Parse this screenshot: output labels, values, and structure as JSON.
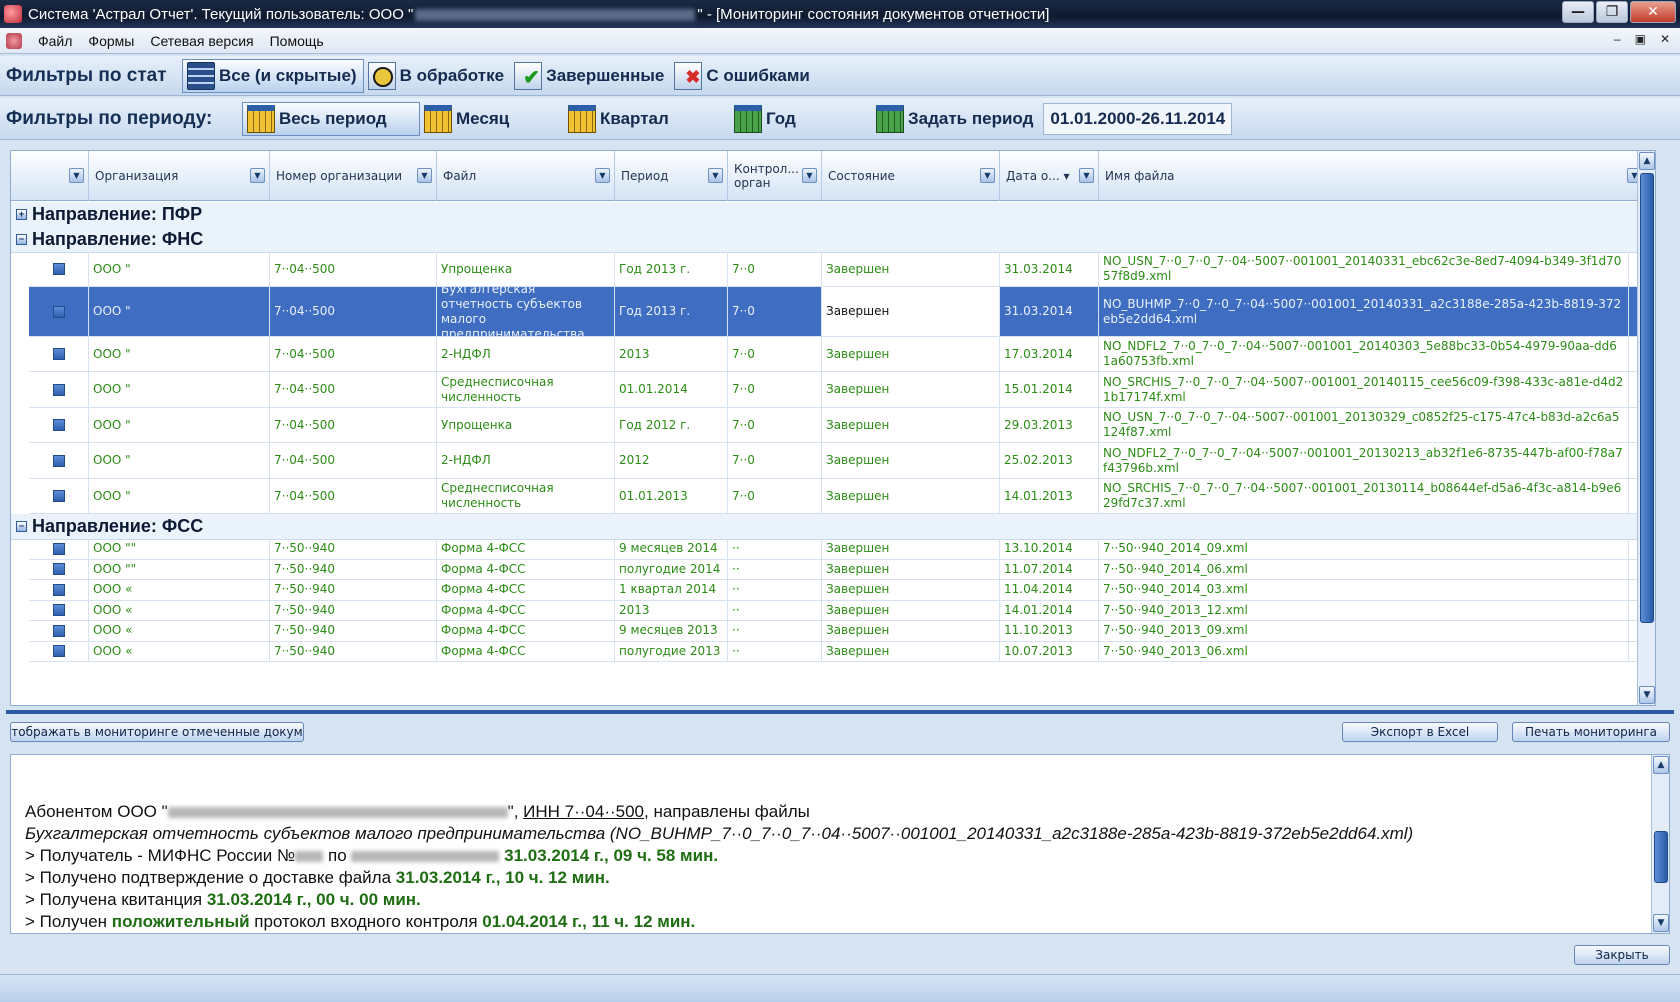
{
  "window": {
    "title_prefix": "Система 'Астрал Отчет'. Текущий пользователь: ООО \"",
    "title_suffix": "\" - [Мониторинг состояния документов отчетности]",
    "min": "—",
    "max": "❐",
    "close": "✕"
  },
  "menu": [
    "Файл",
    "Формы",
    "Сетевая версия",
    "Помощь"
  ],
  "mdi_controls": [
    "–",
    "▣",
    "✕"
  ],
  "status_filters": {
    "label": "Фильтры по стат",
    "buttons": [
      {
        "label": "Все (и скрытые)",
        "icon": "stack-icon",
        "active": true
      },
      {
        "label": "В обработке",
        "icon": "clock-icon",
        "active": false
      },
      {
        "label": "Завершенные",
        "icon": "check-icon",
        "active": false
      },
      {
        "label": "С ошибками",
        "icon": "error-icon",
        "active": false
      }
    ]
  },
  "period_filters": {
    "label": "Фильтры по периоду:",
    "buttons": [
      {
        "label": "Весь период",
        "icon": "calendar-icon",
        "active": true
      },
      {
        "label": "Месяц",
        "icon": "calendar-icon",
        "active": false
      },
      {
        "label": "Квартал",
        "icon": "calendar-icon",
        "active": false
      },
      {
        "label": "Год",
        "icon": "calendar-green-icon",
        "active": false
      },
      {
        "label": "Задать период",
        "icon": "calendar-edit-icon",
        "active": false
      }
    ],
    "range": "01.01.2000-26.11.2014"
  },
  "grid": {
    "columns": [
      "",
      "Организация",
      "Номер организации",
      "Файл",
      "Период",
      "Контрол...\nорган",
      "Состояние",
      "Дата о... ▾",
      "Имя файла"
    ],
    "groups": [
      {
        "label": "Направление: ПФР",
        "expander": "+"
      },
      {
        "label": "Направление: ФНС",
        "expander": "−"
      },
      {
        "label": "Направление: ФСС",
        "expander": "−"
      }
    ],
    "fns_rows": [
      {
        "org": "ООО \"",
        "num": "7··04··500",
        "file": "Упрощенка",
        "period": "Год 2013 г.",
        "organ": "7··0",
        "state": "Завершен",
        "date": "31.03.2014",
        "fname": "NO_USN_7··0_7··0_7··04··5007··001001_20140331_ebc62c3e-8ed7-4094-b349-3f1d7057f8d9.xml"
      },
      {
        "org": "ООО \"",
        "num": "7··04··500",
        "file": "Бухгалтерская отчетность субъектов малого предпринимательства",
        "period": "Год 2013 г.",
        "organ": "7··0",
        "state": "Завершен",
        "date": "31.03.2014",
        "fname": "NO_BUHMP_7··0_7··0_7··04··5007··001001_20140331_a2c3188e-285a-423b-8819-372eb5e2dd64.xml",
        "selected": true
      },
      {
        "org": "ООО \"",
        "num": "7··04··500",
        "file": "2-НДФЛ",
        "period": "2013",
        "organ": "7··0",
        "state": "Завершен",
        "date": "17.03.2014",
        "fname": "NO_NDFL2_7··0_7··0_7··04··5007··001001_20140303_5e88bc33-0b54-4979-90aa-dd61a60753fb.xml"
      },
      {
        "org": "ООО \"",
        "num": "7··04··500",
        "file": "Среднесписочная численность",
        "period": "01.01.2014",
        "organ": "7··0",
        "state": "Завершен",
        "date": "15.01.2014",
        "fname": "NO_SRCHIS_7··0_7··0_7··04··5007··001001_20140115_cee56c09-f398-433c-a81e-d4d21b17174f.xml"
      },
      {
        "org": "ООО \"",
        "num": "7··04··500",
        "file": "Упрощенка",
        "period": "Год 2012 г.",
        "organ": "7··0",
        "state": "Завершен",
        "date": "29.03.2013",
        "fname": "NO_USN_7··0_7··0_7··04··5007··001001_20130329_c0852f25-c175-47c4-b83d-a2c6a5124f87.xml"
      },
      {
        "org": "ООО \"",
        "num": "7··04··500",
        "file": "2-НДФЛ",
        "period": "2012",
        "organ": "7··0",
        "state": "Завершен",
        "date": "25.02.2013",
        "fname": "NO_NDFL2_7··0_7··0_7··04··5007··001001_20130213_ab32f1e6-8735-447b-af00-f78a7f43796b.xml"
      },
      {
        "org": "ООО \"",
        "num": "7··04··500",
        "file": "Среднесписочная численность",
        "period": "01.01.2013",
        "organ": "7··0",
        "state": "Завершен",
        "date": "14.01.2013",
        "fname": "NO_SRCHIS_7··0_7··0_7··04··5007··001001_20130114_b08644ef-d5a6-4f3c-a814-b9e629fd7c37.xml"
      }
    ],
    "fss_rows": [
      {
        "org": "ООО \"\"",
        "num": "7··50··940",
        "file": "Форма 4-ФСС",
        "period": "9 месяцев 2014",
        "organ": "··",
        "state": "Завершен",
        "date": "13.10.2014",
        "fname": "7··50··940_2014_09.xml"
      },
      {
        "org": "ООО \"\"",
        "num": "7··50··940",
        "file": "Форма 4-ФСС",
        "period": "полугодие 2014",
        "organ": "··",
        "state": "Завершен",
        "date": "11.07.2014",
        "fname": "7··50··940_2014_06.xml"
      },
      {
        "org": "ООО «",
        "num": "7··50··940",
        "file": "Форма 4-ФСС",
        "period": "1 квартал 2014",
        "organ": "··",
        "state": "Завершен",
        "date": "11.04.2014",
        "fname": "7··50··940_2014_03.xml"
      },
      {
        "org": "ООО «",
        "num": "7··50··940",
        "file": "Форма 4-ФСС",
        "period": "2013",
        "organ": "··",
        "state": "Завершен",
        "date": "14.01.2014",
        "fname": "7··50··940_2013_12.xml"
      },
      {
        "org": "ООО «",
        "num": "7··50··940",
        "file": "Форма 4-ФСС",
        "period": "9 месяцев 2013",
        "organ": "··",
        "state": "Завершен",
        "date": "11.10.2013",
        "fname": "7··50··940_2013_09.xml"
      },
      {
        "org": "ООО «",
        "num": "7··50··940",
        "file": "Форма 4-ФСС",
        "period": "полугодие 2013",
        "organ": "··",
        "state": "Завершен",
        "date": "10.07.2013",
        "fname": "7··50··940_2013_06.xml"
      }
    ]
  },
  "buttons": {
    "show_marked": "отображать в мониторинге отмеченные докуме",
    "export_excel": "Экспорт в Excel",
    "print_monitoring": "Печать мониторинга",
    "close": "Закрыть"
  },
  "info": {
    "line1_a": "Абонентом ООО \"",
    "line1_b": "\", ",
    "line1_inn": "ИНН 7··04··500",
    "line1_c": ", направлены файлы",
    "line2": "Бухгалтерская отчетность субъектов малого предпринимательства (NO_BUHMP_7··0_7··0_7··04··5007··001001_20140331_a2c3188e-285a-423b-8819-372eb5e2dd64.xml)",
    "line3_a": ">  Получатель - МИФНС России №",
    "line3_b": " по ",
    "line3_time": "31.03.2014 г., 09 ч. 58 мин.",
    "line4_a": ">  Получено подтверждение о доставке файла ",
    "line4_time": "31.03.2014 г., 10 ч. 12 мин.",
    "line5_a": ">  Получена квитанция ",
    "line5_time": "31.03.2014 г., 00 ч. 00 мин.",
    "line6_a": ">  Получен ",
    "line6_pos": "положительный",
    "line6_b": " протокол входного контроля  ",
    "line6_time": "01.04.2014 г., 11 ч. 12 мин."
  },
  "colors": {
    "accent": "#3e6dc2",
    "ok_text": "#2c8c16"
  }
}
